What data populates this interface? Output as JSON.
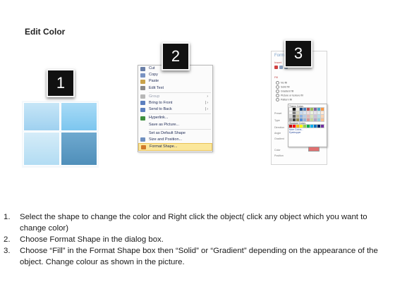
{
  "title": "Edit Color",
  "badges": [
    "1",
    "2",
    "3"
  ],
  "context_menu": {
    "items": [
      {
        "label": "Cut",
        "icon": "scissors-icon",
        "color": "#6a7fa8",
        "arrow": "",
        "disabled": false,
        "highlight": false
      },
      {
        "label": "Copy",
        "icon": "copy-icon",
        "color": "#7a93c2",
        "arrow": "",
        "disabled": false,
        "highlight": false
      },
      {
        "label": "Paste",
        "icon": "paste-icon",
        "color": "#c9a24a",
        "arrow": "",
        "disabled": false,
        "highlight": false
      },
      {
        "label": "Edit Text",
        "icon": "edit-text-icon",
        "color": "#8a8a8a",
        "arrow": "",
        "disabled": false,
        "highlight": false
      },
      {
        "label": "Group",
        "icon": "group-icon",
        "color": "#b7b7b7",
        "arrow": "›",
        "disabled": true,
        "highlight": false
      },
      {
        "label": "Bring to Front",
        "icon": "bring-to-front-icon",
        "color": "#5b7fbf",
        "arrow": "| ›",
        "disabled": false,
        "highlight": false
      },
      {
        "label": "Send to Back",
        "icon": "send-to-back-icon",
        "color": "#5b7fbf",
        "arrow": "| ›",
        "disabled": false,
        "highlight": false
      },
      {
        "label": "Hyperlink...",
        "icon": "hyperlink-icon",
        "color": "#3f8f3f",
        "arrow": "",
        "disabled": false,
        "highlight": false
      },
      {
        "label": "Save as Picture...",
        "icon": "",
        "color": "",
        "arrow": "",
        "disabled": false,
        "highlight": false
      },
      {
        "label": "Set as Default Shape",
        "icon": "",
        "color": "",
        "arrow": "",
        "disabled": false,
        "highlight": false
      },
      {
        "label": "Size and Position...",
        "icon": "size-position-icon",
        "color": "#6f8fbf",
        "arrow": "",
        "disabled": false,
        "highlight": false
      },
      {
        "label": "Format Shape...",
        "icon": "format-shape-icon",
        "color": "#d07a2a",
        "arrow": "",
        "disabled": false,
        "highlight": true
      }
    ]
  },
  "dialog": {
    "title": "Form",
    "subtitle": "Insert",
    "section": "Fill",
    "options": [
      "No fill",
      "Solid fill",
      "Gradient fill",
      "Picture or texture fill",
      "Pattern fill"
    ],
    "labels": [
      "Preset",
      "Type",
      "Direction",
      "Angle",
      "Gradient",
      "Color",
      "Position"
    ],
    "palette": {
      "theme_label": "Theme Colors",
      "standard_label": "Standard Colors",
      "more_colors": "More Colors...",
      "eyedropper": "Eyedropper",
      "theme_colors": [
        "#ffffff",
        "#000000",
        "#eeece1",
        "#1f497d",
        "#4f81bd",
        "#c0504d",
        "#9bbb59",
        "#8064a2",
        "#4bacc6",
        "#f79646",
        "#f2f2f2",
        "#7f7f7f",
        "#ddd9c3",
        "#c6d9f0",
        "#dbe5f1",
        "#f2dcdb",
        "#ebf1dd",
        "#e5e0ec",
        "#dbeef3",
        "#fdeada",
        "#d8d8d8",
        "#595959",
        "#c4bd97",
        "#8db3e2",
        "#b8cce4",
        "#e5b9b7",
        "#d7e3bc",
        "#ccc1d9",
        "#b7dde8",
        "#fbd5b5",
        "#a5a5a5",
        "#3f3f3f",
        "#938953",
        "#548dd4",
        "#95b3d7",
        "#d99694",
        "#c3d69b",
        "#b2a2c7",
        "#92cddc",
        "#fac08f"
      ],
      "standard_colors": [
        "#c00000",
        "#ff0000",
        "#ffc000",
        "#ffff00",
        "#92d050",
        "#00b050",
        "#00b0f0",
        "#0070c0",
        "#002060",
        "#7030a0"
      ]
    }
  },
  "steps": [
    {
      "num": "1.",
      "text": "Select the shape to change the color and Right click the object( click any object which you want to change color)"
    },
    {
      "num": "2.",
      "text": "Choose Format Shape in the dialog box."
    },
    {
      "num": "3.",
      "text": "Choose “Fill” in the Format Shape box then “Solid” or “Gradient” depending on the appearance of the object. Change colour as shown in the picture."
    }
  ]
}
